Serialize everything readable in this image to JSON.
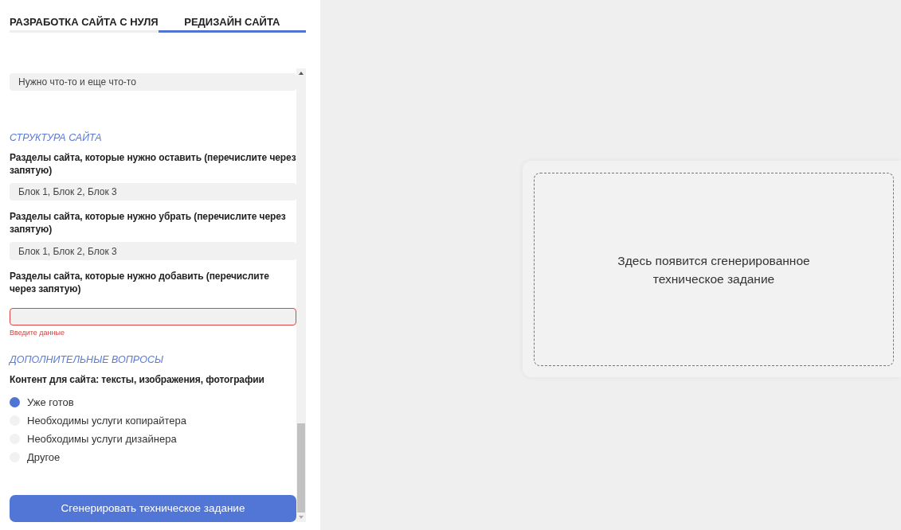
{
  "tabs": [
    {
      "label": "РАЗРАБОТКА САЙТА С НУЛЯ",
      "selected": false
    },
    {
      "label": "РЕДИЗАЙН САЙТА",
      "selected": true
    }
  ],
  "form": [
    {
      "kind": "field",
      "value": "Нужно что-то и еще что-то",
      "error": false
    },
    {
      "kind": "heading",
      "text": "СТРУКТУРА САЙТА"
    },
    {
      "kind": "label",
      "text": "Разделы сайта, которые нужно оставить (перечислите через запятую)"
    },
    {
      "kind": "field",
      "value": "Блок 1, Блок 2, Блок 3",
      "error": false
    },
    {
      "kind": "label",
      "text": "Разделы сайта, которые нужно убрать (перечислите через запятую)"
    },
    {
      "kind": "field",
      "value": "Блок 1, Блок 2, Блок 3",
      "error": false
    },
    {
      "kind": "label",
      "text": "Разделы сайта, которые нужно добавить (перечислите через запятую)"
    },
    {
      "kind": "field",
      "error": true,
      "error_text": "Введите данные"
    },
    {
      "kind": "heading",
      "text": "ДОПОЛНИТЕЛЬНЫЕ ВОПРОСЫ"
    },
    {
      "kind": "label",
      "text": "Контент для сайта: тексты, изображения, фотографии"
    },
    {
      "kind": "radios",
      "options": [
        {
          "label": "Уже готов",
          "selected": true
        },
        {
          "label": "Необходимы услуги копирайтера",
          "selected": false
        },
        {
          "label": "Необходимы услуги дизайнера",
          "selected": false
        },
        {
          "label": "Другое",
          "selected": false
        }
      ]
    }
  ],
  "submit_button": "Сгенерировать техническое задание",
  "preview": {
    "placeholder": "Здесь появится сгенерированное техническое задание"
  }
}
